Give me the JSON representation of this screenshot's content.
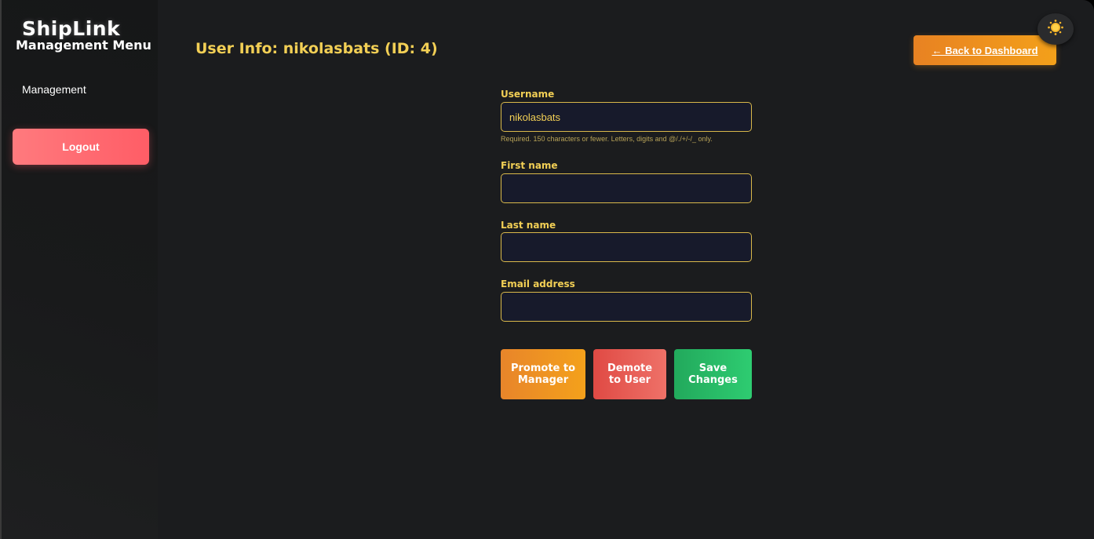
{
  "sidebar": {
    "brand": "ShipLink",
    "menu_title": "Management Menu",
    "items": [
      {
        "label": "Management"
      }
    ],
    "logout_label": "Logout"
  },
  "header": {
    "title": "User Info: nikolasbats (ID: 4)",
    "back_label": "← Back to Dashboard",
    "theme_icon": "sun-icon"
  },
  "form": {
    "username": {
      "label": "Username",
      "value": "nikolasbats",
      "help": "Required. 150 characters or fewer. Letters, digits and @/./+/-/_ only."
    },
    "first_name": {
      "label": "First name",
      "value": ""
    },
    "last_name": {
      "label": "Last name",
      "value": ""
    },
    "email": {
      "label": "Email address",
      "value": ""
    }
  },
  "actions": {
    "promote_label": "Promote to Manager",
    "demote_label": "Demote to User",
    "save_label": "Save Changes"
  },
  "colors": {
    "accent_gold": "#f2cf55",
    "orange": "#f09a1f",
    "red": "#e85a54",
    "green": "#2ecc71",
    "logout": "#ff6b72"
  }
}
